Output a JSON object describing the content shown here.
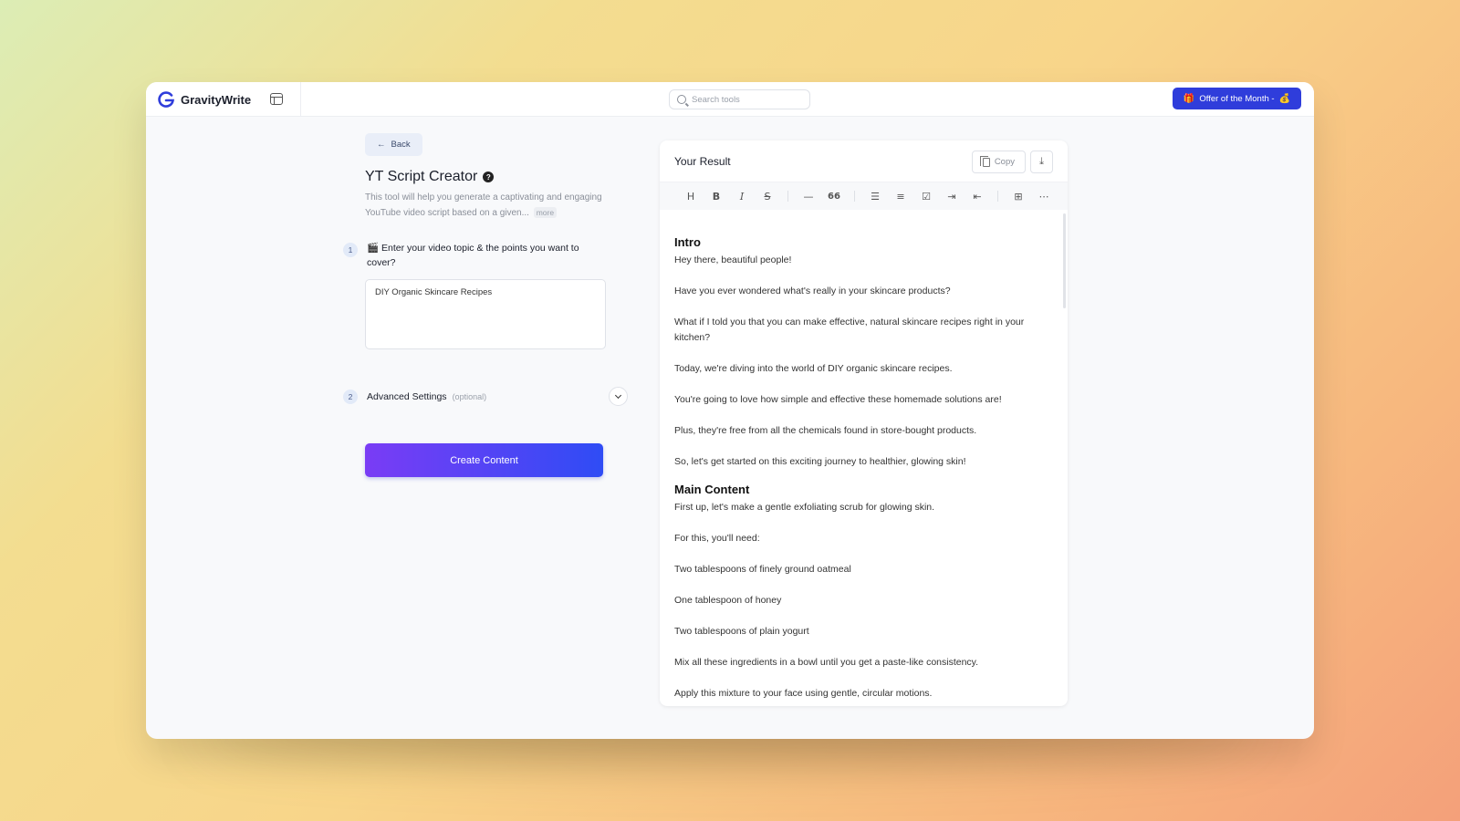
{
  "app": {
    "brand": "GravityWrite",
    "search_placeholder": "Search tools",
    "offer_label": "Offer of the Month -",
    "offer_icon": "🎁",
    "offer_trailing_icon": "💰",
    "brand_color": "#2f3ddb"
  },
  "tool": {
    "back_label": "Back",
    "title": "YT Script Creator",
    "description": "This tool will help you generate a captivating and engaging YouTube video script based on a given...",
    "more_label": "more",
    "steps": [
      {
        "number": "1",
        "label": "🎬 Enter your video topic & the points you want to cover?",
        "value": "DIY Organic Skincare Recipes"
      },
      {
        "number": "2",
        "label": "Advanced Settings",
        "optional": "(optional)"
      }
    ],
    "create_label": "Create Content"
  },
  "result": {
    "title": "Your Result",
    "copy_label": "Copy",
    "toolbar": [
      "H",
      "B",
      "I",
      "S",
      "—",
      "66",
      "bullet-list",
      "ordered-list",
      "checklist",
      "indent",
      "outdent",
      "table",
      "more"
    ],
    "sections": [
      {
        "heading": "Intro",
        "paragraphs": [
          "Hey there, beautiful people!",
          "Have you ever wondered what's really in your skincare products?",
          "What if I told you that you can make effective, natural skincare recipes right in your kitchen?",
          "Today, we're diving into the world of DIY organic skincare recipes.",
          "You're going to love how simple and effective these homemade solutions are!",
          "Plus, they're free from all the chemicals found in store-bought products.",
          "So, let's get started on this exciting journey to healthier, glowing skin!"
        ]
      },
      {
        "heading": "Main Content",
        "paragraphs": [
          "First up, let's make a gentle exfoliating scrub for glowing skin.",
          "For this, you'll need:",
          "Two tablespoons of finely ground oatmeal",
          "One tablespoon of honey",
          "Two tablespoons of plain yogurt",
          "Mix all these ingredients in a bowl until you get a paste-like consistency.",
          "Apply this mixture to your face using gentle, circular motions."
        ]
      }
    ]
  }
}
